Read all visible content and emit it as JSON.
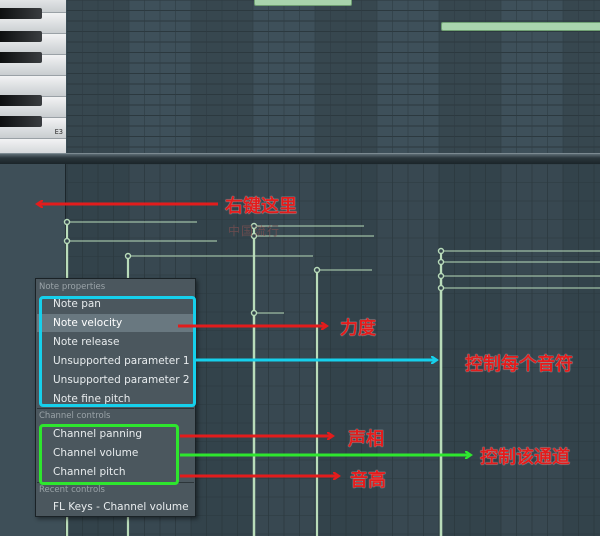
{
  "piano_roll": {
    "key_label": "E3"
  },
  "context_menu": {
    "sections": {
      "note_properties": "Note properties",
      "channel_controls": "Channel controls",
      "recent_controls": "Recent controls"
    },
    "note_items": [
      {
        "label": "Note pan"
      },
      {
        "label": "Note velocity",
        "selected": true
      },
      {
        "label": "Note release"
      },
      {
        "label": "Unsupported parameter 1"
      },
      {
        "label": "Unsupported parameter 2"
      },
      {
        "label": "Note fine pitch"
      }
    ],
    "channel_items": [
      {
        "label": "Channel panning"
      },
      {
        "label": "Channel volume"
      },
      {
        "label": "Channel pitch"
      }
    ],
    "recent_items": [
      {
        "label": "FL Keys - Channel volume"
      }
    ]
  },
  "annotations": {
    "right_click_here": "右键这里",
    "velocity": "力度",
    "control_each_note": "控制每个音符",
    "pan": "声相",
    "control_channel": "控制该通道",
    "pitch": "音高",
    "watermark": "中国流行"
  },
  "colors": {
    "arrow_red": "#e31c1c",
    "box_cyan": "#16d0ec",
    "box_green": "#2ee62e",
    "note_green": "#a9d4ad",
    "stem_green": "#b9dcba"
  }
}
